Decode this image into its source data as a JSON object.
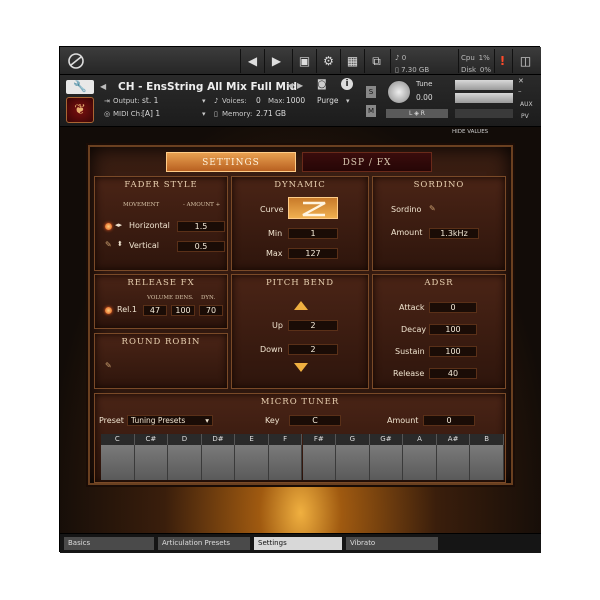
{
  "host": {
    "voices_count": "0",
    "memory": "7.30 GB",
    "cpu_label": "Cpu",
    "cpu_value": "1%",
    "disk_label": "Disk",
    "disk_value": "0%"
  },
  "instrument": {
    "title": "CH - EnsString All Mix Full Mid",
    "output_label": "Output:",
    "output_value": "st. 1",
    "voices_label": "Voices:",
    "voices_value": "0",
    "max_label": "Max:",
    "max_value": "1000",
    "purge_label": "Purge",
    "midi_label": "MIDI Ch:",
    "midi_value": "[A] 1",
    "memory_label": "Memory:",
    "memory_value": "2.71 GB",
    "tune_label": "Tune",
    "tune_value": "0.00",
    "s_label": "S",
    "m_label": "M",
    "pan_label": "L ◈ R",
    "aux_label": "AUX",
    "pv_label": "PV",
    "hide_values": "HIDE VALUES"
  },
  "tabs": {
    "settings": "SETTINGS",
    "dsp": "DSP / FX"
  },
  "fader_style": {
    "title": "FADER STYLE",
    "movement_label": "MOVEMENT",
    "amount_label": "-  AMOUNT  +",
    "horizontal_label": "Horizontal",
    "horizontal_value": "1.5",
    "vertical_label": "Vertical",
    "vertical_value": "0.5"
  },
  "dynamic": {
    "title": "DYNAMIC",
    "curve_label": "Curve",
    "min_label": "Min",
    "min_value": "1",
    "max_label": "Max",
    "max_value": "127"
  },
  "sordino": {
    "title": "SORDINO",
    "sordino_label": "Sordino",
    "amount_label": "Amount",
    "amount_value": "1.3kHz"
  },
  "release_fx": {
    "title": "RELEASE FX",
    "rel_label": "Rel.1",
    "volume_label": "VOLUME",
    "volume_value": "47",
    "dens_label": "DENS.",
    "dens_value": "100",
    "dyn_label": "DYN.",
    "dyn_value": "70"
  },
  "round_robin": {
    "title": "ROUND ROBIN"
  },
  "pitch_bend": {
    "title": "PITCH BEND",
    "up_label": "Up",
    "up_value": "2",
    "down_label": "Down",
    "down_value": "2"
  },
  "adsr": {
    "title": "ADSR",
    "attack_label": "Attack",
    "attack_value": "0",
    "decay_label": "Decay",
    "decay_value": "100",
    "sustain_label": "Sustain",
    "sustain_value": "100",
    "release_label": "Release",
    "release_value": "40"
  },
  "micro_tuner": {
    "title": "MICRO TUNER",
    "preset_label": "Preset",
    "preset_value": "Tuning Presets",
    "key_label": "Key",
    "key_value": "C",
    "amount_label": "Amount",
    "amount_value": "0",
    "notes": [
      "C",
      "C#",
      "D",
      "D#",
      "E",
      "F",
      "F#",
      "G",
      "G#",
      "A",
      "A#",
      "B"
    ]
  },
  "bottom_tabs": [
    "Basics",
    "Articulation Presets",
    "Settings",
    "Vibrato"
  ],
  "colors": {
    "accent_orange": "#e8a050",
    "led_orange": "#e05010",
    "panel_brown": "#4a2416"
  }
}
